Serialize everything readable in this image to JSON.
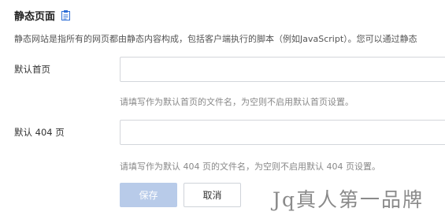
{
  "section": {
    "title": "静态页面",
    "icon": "document-icon"
  },
  "description": "静态网站是指所有的网页都由静态内容构成，包括客户端执行的脚本（例如JavaScript）。您可以通过静态",
  "form": {
    "default_home": {
      "label": "默认首页",
      "value": "",
      "placeholder": "",
      "hint": "请填写作为默认首页的文件名，为空则不启用默认首页设置。"
    },
    "default_404": {
      "label": "默认 404 页",
      "value": "",
      "placeholder": "",
      "hint": "请填写作为默认 404 页的文件名，为空则不启用默认 404 页设置。"
    }
  },
  "actions": {
    "save_label": "保存",
    "cancel_label": "取消"
  },
  "watermark": "Jq真人第一品牌",
  "colors": {
    "accent": "#2f6fd6",
    "save_disabled_bg": "#b8cbe9",
    "border": "#d3d6db",
    "hint_text": "#888888"
  }
}
